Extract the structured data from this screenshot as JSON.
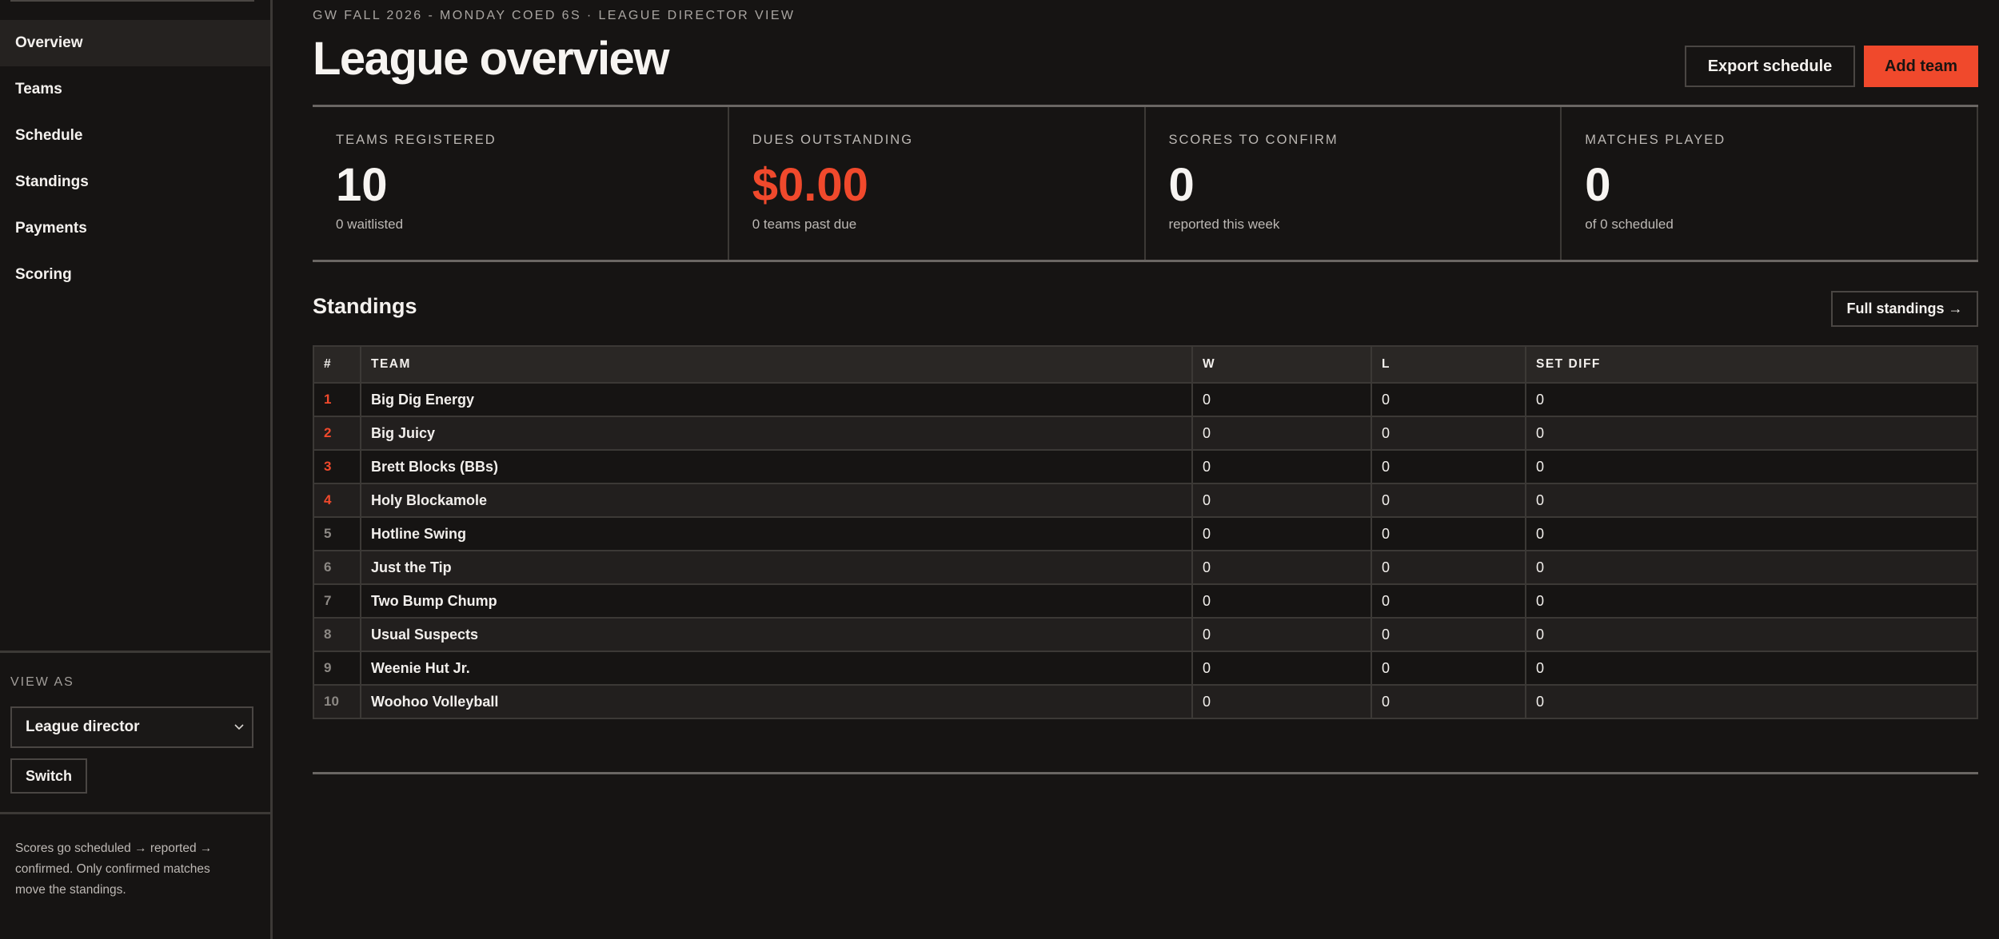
{
  "sidebar": {
    "nav": [
      {
        "label": "Overview",
        "active": true
      },
      {
        "label": "Teams",
        "active": false
      },
      {
        "label": "Schedule",
        "active": false
      },
      {
        "label": "Standings",
        "active": false
      },
      {
        "label": "Payments",
        "active": false
      },
      {
        "label": "Scoring",
        "active": false
      }
    ],
    "view_as_label": "VIEW AS",
    "role_selected": "League director",
    "switch_label": "Switch",
    "help_text": "Scores go scheduled → reported → confirmed. Only confirmed matches move the standings."
  },
  "header": {
    "kicker": "GW FALL 2026 - MONDAY COED 6S · LEAGUE DIRECTOR VIEW",
    "title": "League overview",
    "export_label": "Export schedule",
    "add_team_label": "Add team"
  },
  "stats": [
    {
      "label": "TEAMS REGISTERED",
      "value": "10",
      "sub": "0 waitlisted",
      "accent": false
    },
    {
      "label": "DUES OUTSTANDING",
      "value": "$0.00",
      "sub": "0 teams past due",
      "accent": true
    },
    {
      "label": "SCORES TO CONFIRM",
      "value": "0",
      "sub": "reported this week",
      "accent": false
    },
    {
      "label": "MATCHES PLAYED",
      "value": "0",
      "sub": "of 0 scheduled",
      "accent": false
    }
  ],
  "standings": {
    "title": "Standings",
    "full_link": "Full standings →",
    "columns": [
      "#",
      "TEAM",
      "W",
      "L",
      "SET DIFF"
    ],
    "rows": [
      {
        "rank": "1",
        "team": "Big Dig Energy",
        "w": "0",
        "l": "0",
        "diff": "0"
      },
      {
        "rank": "2",
        "team": "Big Juicy",
        "w": "0",
        "l": "0",
        "diff": "0"
      },
      {
        "rank": "3",
        "team": "Brett Blocks (BBs)",
        "w": "0",
        "l": "0",
        "diff": "0"
      },
      {
        "rank": "4",
        "team": "Holy Blockamole",
        "w": "0",
        "l": "0",
        "diff": "0"
      },
      {
        "rank": "5",
        "team": "Hotline Swing",
        "w": "0",
        "l": "0",
        "diff": "0"
      },
      {
        "rank": "6",
        "team": "Just the Tip",
        "w": "0",
        "l": "0",
        "diff": "0"
      },
      {
        "rank": "7",
        "team": "Two Bump Chump",
        "w": "0",
        "l": "0",
        "diff": "0"
      },
      {
        "rank": "8",
        "team": "Usual Suspects",
        "w": "0",
        "l": "0",
        "diff": "0"
      },
      {
        "rank": "9",
        "team": "Weenie Hut Jr.",
        "w": "0",
        "l": "0",
        "diff": "0"
      },
      {
        "rank": "10",
        "team": "Woohoo Volleyball",
        "w": "0",
        "l": "0",
        "diff": "0"
      }
    ]
  },
  "colors": {
    "accent": "#f0492c",
    "background": "#161413"
  }
}
